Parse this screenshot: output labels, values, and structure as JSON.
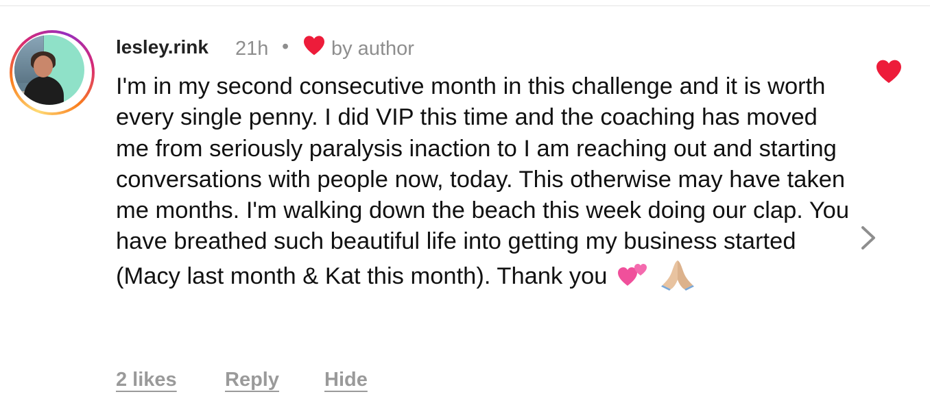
{
  "comment": {
    "username": "lesley.rink",
    "time": "21h",
    "separator": "•",
    "liked_by_label": "by author",
    "text": "I'm in my second consecutive month in this challenge and it is worth every single penny. I did VIP this time and the coaching has moved me from seriously paralysis inaction to I am reaching out and starting conversations with people now, today. This otherwise may have taken me months. I'm walking down the beach this week doing our clap. You have breathed such beautiful life into getting my business started (Macy last month & Kat this month). Thank you",
    "emojis": [
      "two-hearts-emoji",
      "folded-hands-emoji"
    ]
  },
  "actions": {
    "likes": "2 likes",
    "reply": "Reply",
    "hide": "Hide"
  },
  "icons": {
    "author_heart": "heart-icon",
    "like": "heart-icon",
    "expand": "chevron-right-icon"
  },
  "colors": {
    "heart": "#ed1c3a",
    "muted_text": "#8e8e8e",
    "action_text": "#9a9a9a"
  }
}
